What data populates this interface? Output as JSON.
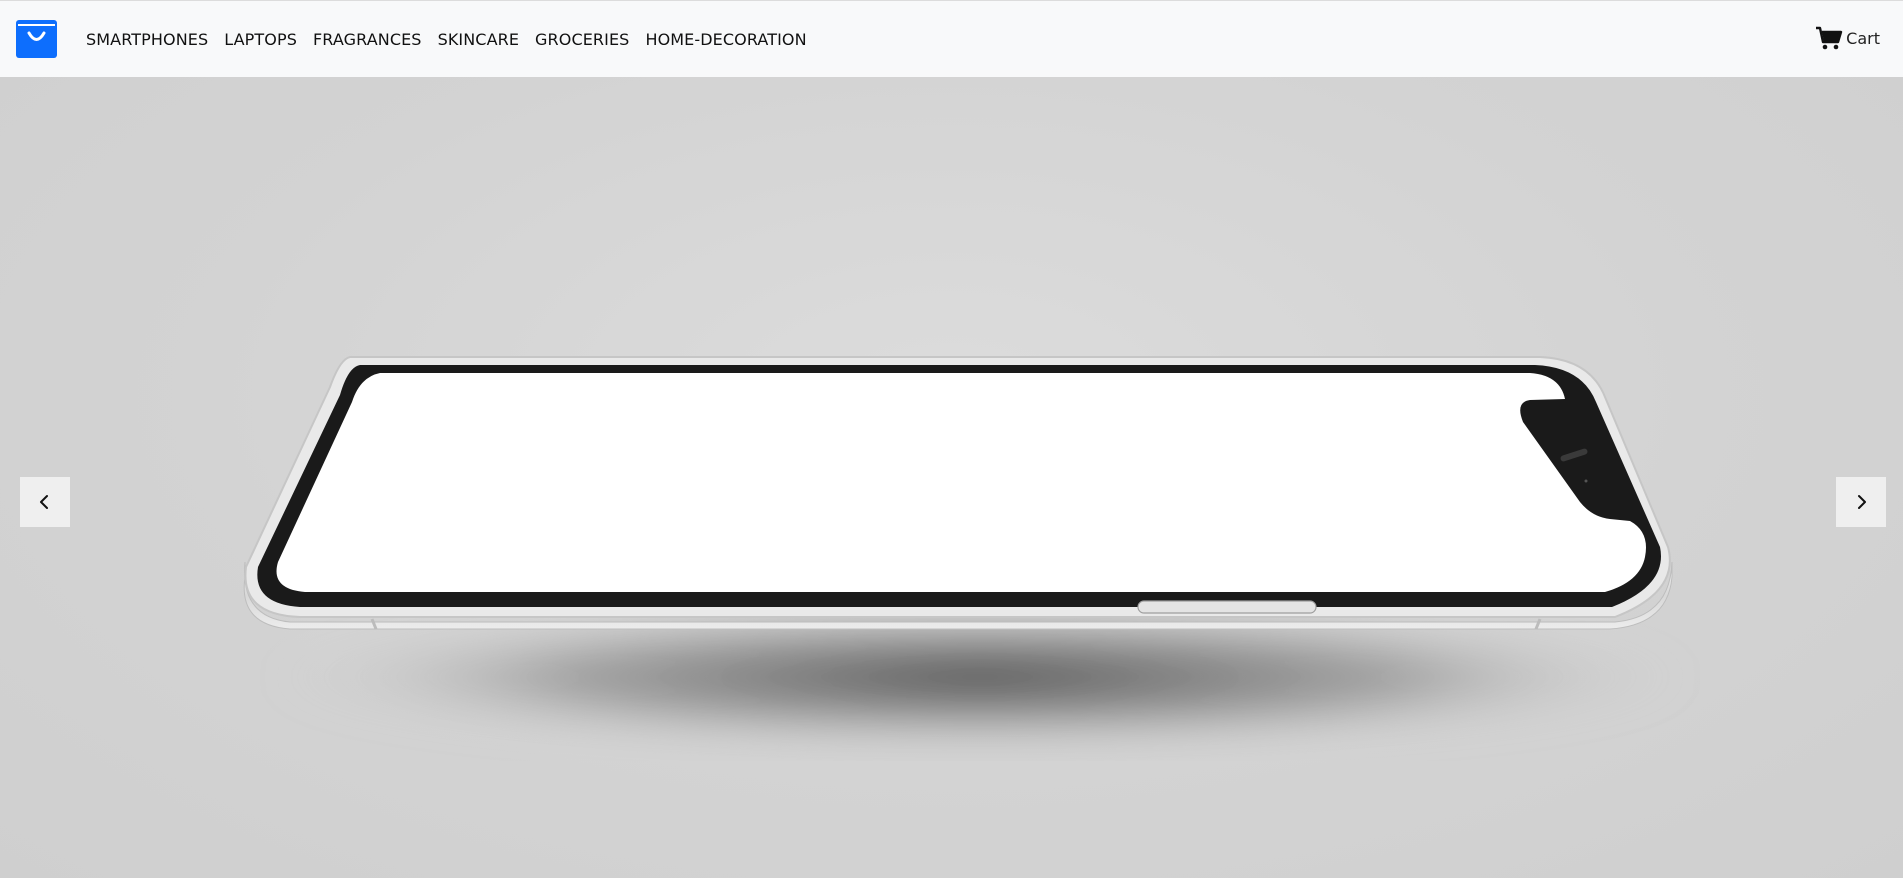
{
  "brand": {
    "logo_icon": "shopping-bag-icon",
    "color": "#0d6efd"
  },
  "nav": {
    "items": [
      {
        "label": "SMARTPHONES"
      },
      {
        "label": "LAPTOPS"
      },
      {
        "label": "FRAGRANCES"
      },
      {
        "label": "SKINCARE"
      },
      {
        "label": "GROCERIES"
      },
      {
        "label": "HOME-DECORATION"
      }
    ]
  },
  "cart": {
    "icon": "cart-icon",
    "label": "Cart"
  },
  "carousel": {
    "prev_icon": "chevron-left-icon",
    "next_icon": "chevron-right-icon",
    "slide_image": "smartphone-slide"
  }
}
